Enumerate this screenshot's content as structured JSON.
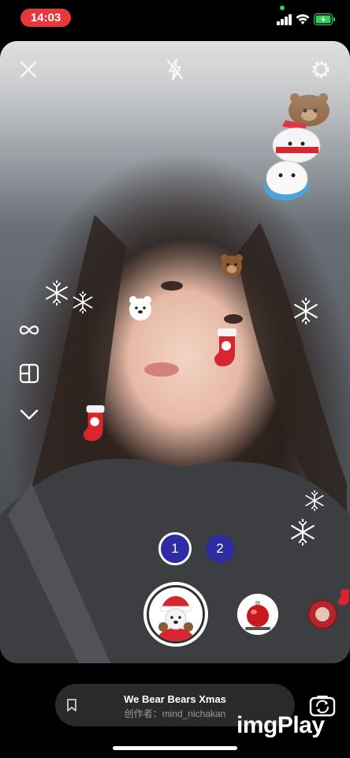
{
  "status_bar": {
    "time": "14:03"
  },
  "camera": {
    "top_controls": [
      "close-icon",
      "flash-off-icon",
      "settings-gear-icon"
    ],
    "side_tools": [
      "boomerang-infinity-icon",
      "layout-grid-icon",
      "chevron-down-icon"
    ],
    "counters": {
      "first": "1",
      "second": "2"
    }
  },
  "effect": {
    "name": "We Bear Bears Xmas",
    "creator": "创作者：mind_nichakan"
  },
  "watermark": "imgPlay",
  "colors": {
    "time_pill": "#e8383b",
    "counter_fill": "#2d2ca3",
    "effect_bar": "#2a2a2c"
  }
}
